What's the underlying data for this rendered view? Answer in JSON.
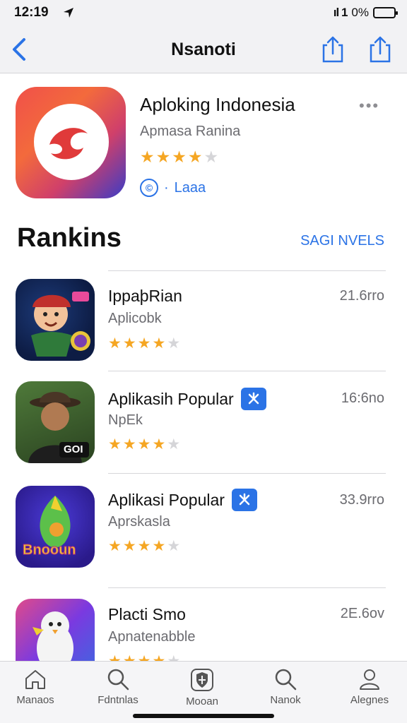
{
  "status_bar": {
    "time": "12:19",
    "signal": "ıl 1",
    "battery_percent": "0%"
  },
  "nav": {
    "title": "Nsanoti"
  },
  "featured": {
    "title": "Aploking Indonesia",
    "subtitle": "Apmasa Ranina",
    "rating": 4,
    "action_label": "Laaa",
    "action_icon_char": "©",
    "more_label": "•••",
    "colors": {
      "gradient_start": "#f0504a",
      "gradient_end": "#3a3cc6"
    }
  },
  "section": {
    "title": "Rankins",
    "see_all": "SAGI NVELS"
  },
  "apps": [
    {
      "name": "IppaþRian",
      "subtitle": "Aplicobk",
      "size": "21.6rro",
      "rating": 4,
      "badge": false,
      "icon_label": ""
    },
    {
      "name": "Aplikasih Popular",
      "subtitle": "NpEk",
      "size": "16:6no",
      "rating": 4,
      "badge": true,
      "icon_label": "GOI"
    },
    {
      "name": "Aplikasi Popular",
      "subtitle": "Aprskasla",
      "size": "33.9rro",
      "rating": 4,
      "badge": true,
      "icon_label": "Bnooun"
    },
    {
      "name": "Placti Smo",
      "subtitle": "Apnatenabble",
      "size": "2E.6ov",
      "rating": 4,
      "badge": false,
      "icon_label": ""
    }
  ],
  "tabs": [
    {
      "label": "Manaos",
      "icon": "home-icon"
    },
    {
      "label": "Fdntnlas",
      "icon": "search-icon"
    },
    {
      "label": "Mooan",
      "icon": "shield-icon"
    },
    {
      "label": "Nanok",
      "icon": "search-icon"
    },
    {
      "label": "Alegnes",
      "icon": "person-icon"
    }
  ],
  "accent_color": "#2b73e6",
  "star_color": "#f5a623"
}
